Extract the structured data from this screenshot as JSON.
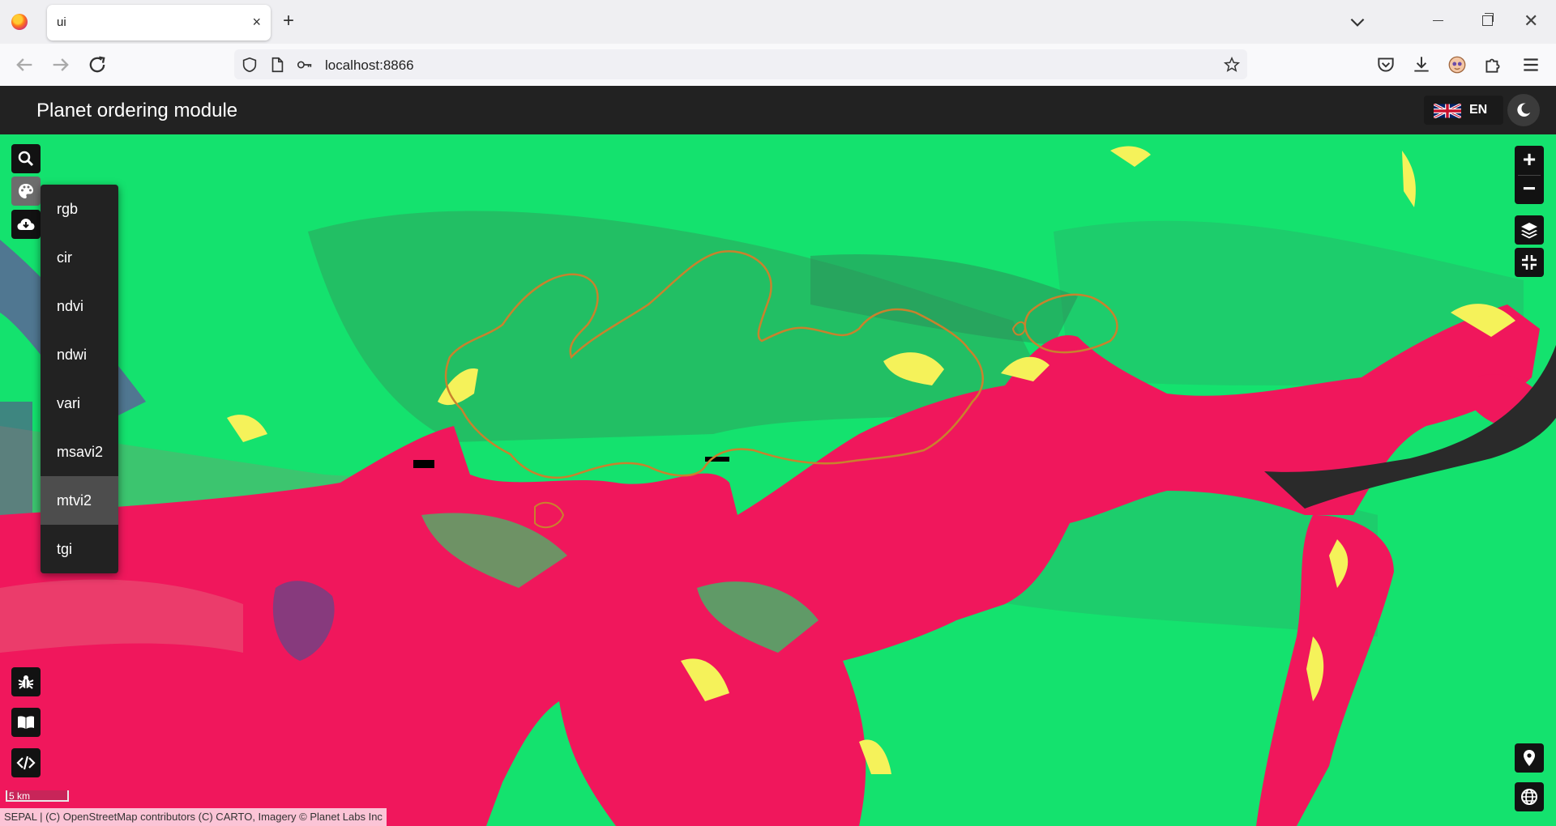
{
  "browser": {
    "tab_title": "ui",
    "url": "localhost:8866",
    "tab_close_glyph": "×",
    "new_tab_glyph": "+",
    "win_close_glyph": "✕"
  },
  "app": {
    "title": "Planet ordering module",
    "language": "EN"
  },
  "map": {
    "zoom_in": "+",
    "zoom_out": "−",
    "scale_label": "5 km",
    "attribution": "SEPAL | (C) OpenStreetMap contributors (C) CARTO, Imagery © Planet Labs Inc",
    "colors": {
      "green": "#14e26e",
      "dark_green": "#2ea35c",
      "pink": "#f0175c",
      "yellow": "#f5f25a",
      "aoi_outline": "#c8822d"
    }
  },
  "viz_menu": {
    "items": [
      "rgb",
      "cir",
      "ndvi",
      "ndwi",
      "vari",
      "msavi2",
      "mtvi2",
      "tgi"
    ],
    "selected": "mtvi2"
  },
  "left_controls": [
    "search-icon",
    "palette-icon",
    "cloud-download-icon"
  ],
  "bottom_left_controls": [
    "bug-icon",
    "book-icon",
    "code-icon"
  ],
  "right_controls": [
    "layers-icon",
    "fullscreen-exit-icon",
    "map-marker-icon",
    "globe-icon"
  ]
}
